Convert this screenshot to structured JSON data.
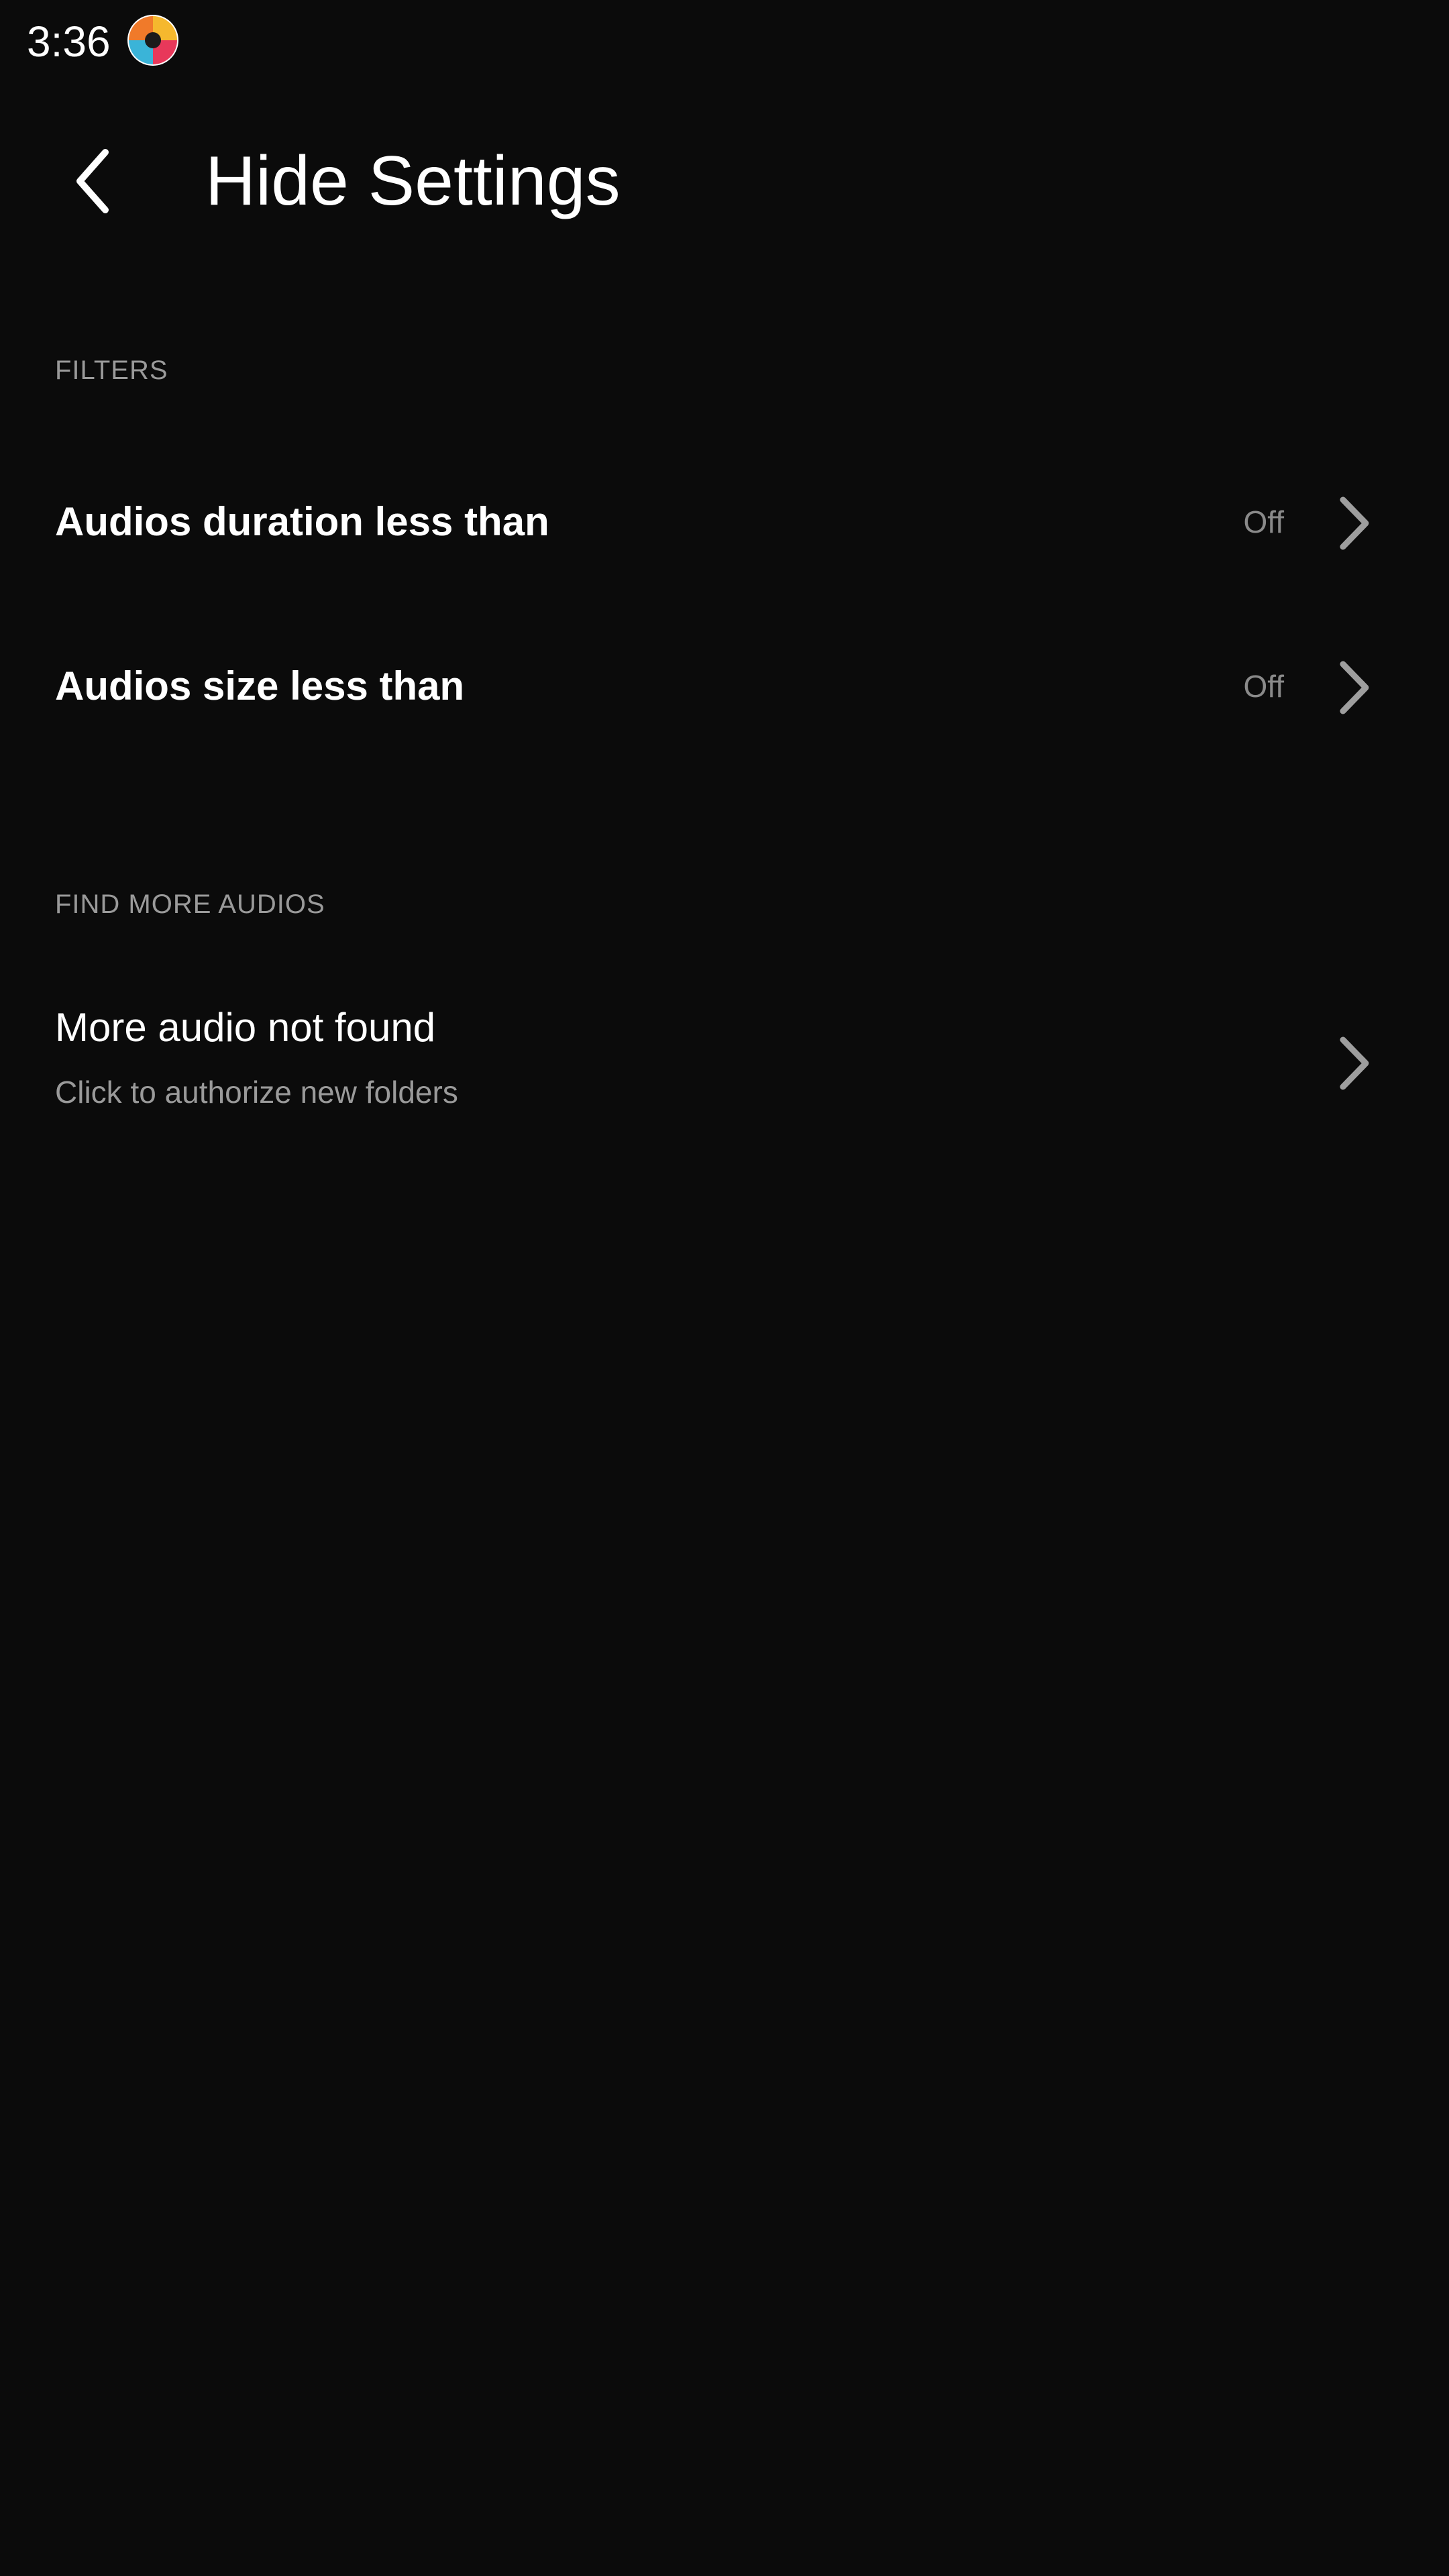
{
  "status_bar": {
    "time": "3:36",
    "app_icon": "colorful-app-icon"
  },
  "header": {
    "title": "Hide Settings",
    "back_icon": "chevron-left-icon"
  },
  "sections": [
    {
      "header": "FILTERS",
      "items": [
        {
          "label": "Audios duration less than",
          "value": "Off",
          "icon": "chevron-right-icon"
        },
        {
          "label": "Audios size less than",
          "value": "Off",
          "icon": "chevron-right-icon"
        }
      ]
    },
    {
      "header": "FIND MORE AUDIOS",
      "items": [
        {
          "label": "More audio not found",
          "subtitle": "Click to authorize new folders",
          "icon": "chevron-right-icon"
        }
      ]
    }
  ],
  "colors": {
    "background": "#0b0b0b",
    "text_primary": "#ffffff",
    "text_secondary": "#9a9a9a",
    "chevron": "#9e9e9e"
  }
}
